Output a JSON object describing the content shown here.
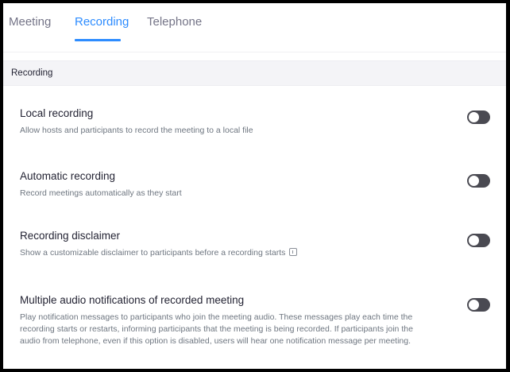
{
  "tabs": [
    {
      "label": "Meeting"
    },
    {
      "label": "Recording"
    },
    {
      "label": "Telephone"
    }
  ],
  "active_tab": "Recording",
  "accent_color": "#2d8cff",
  "section": {
    "title": "Recording"
  },
  "settings": [
    {
      "title": "Local recording",
      "description": "Allow hosts and participants to record the meeting to a local file",
      "enabled": false
    },
    {
      "title": "Automatic recording",
      "description": "Record meetings automatically as they start",
      "enabled": false
    },
    {
      "title": "Recording disclaimer",
      "description": "Show a customizable disclaimer to participants before a recording starts",
      "icon": "info-icon",
      "enabled": false
    },
    {
      "title": "Multiple audio notifications of recorded meeting",
      "description": "Play notification messages to participants who join the meeting audio. These messages play each time the recording starts or restarts, informing participants that the meeting is being recorded. If participants join the audio from telephone, even if this option is disabled, users will hear one notification message per meeting.",
      "enabled": false
    }
  ]
}
